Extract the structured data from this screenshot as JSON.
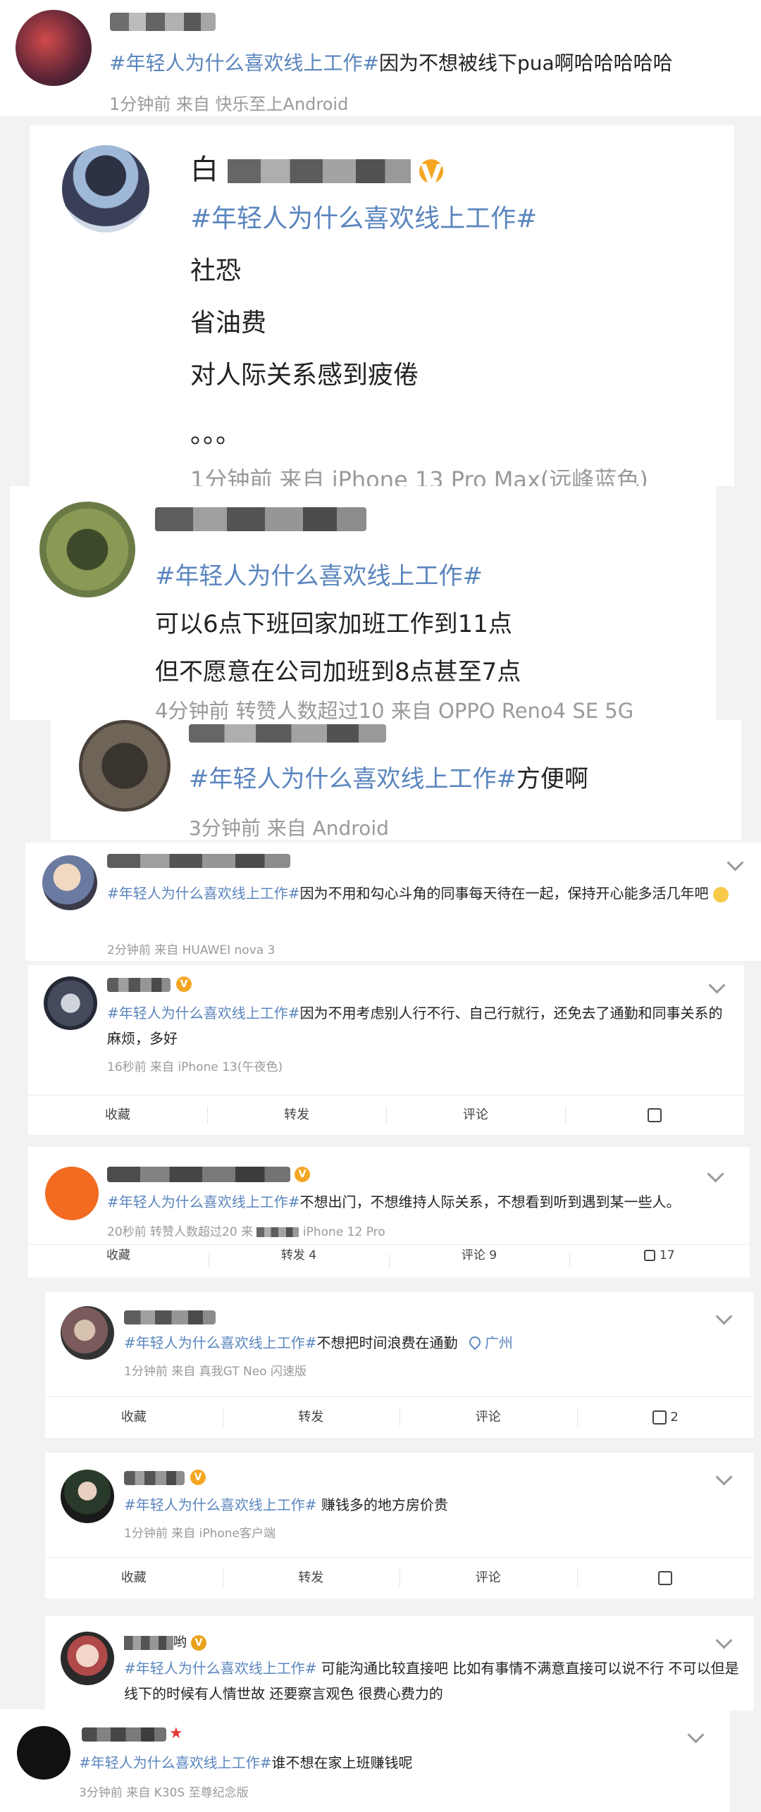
{
  "hashtag": "#年轻人为什么喜欢线上工作#",
  "colors": {
    "link": "#5a85be",
    "meta": "#9a9a9a",
    "badge": "#f4a623",
    "background": "#f2f2f2"
  },
  "posts": [
    {
      "name": "",
      "text": "因为不想被线下pua啊哈哈哈哈哈",
      "meta": "1分钟前  来自 快乐至上Android"
    },
    {
      "name": "白",
      "text_lines": [
        "社恐",
        "省油费",
        "对人际关系感到疲倦",
        "。。。"
      ],
      "meta": "1分钟前  来自 iPhone 13 Pro Max(远峰蓝色)"
    },
    {
      "name": "",
      "text_lines": [
        "可以6点下班回家加班工作到11点",
        "但不愿意在公司加班到8点甚至7点"
      ],
      "meta": "4分钟前  转赞人数超过10  来自 OPPO Reno4 SE 5G"
    },
    {
      "name": "",
      "text": "方便啊",
      "meta": "3分钟前  来自 Android"
    },
    {
      "name": "",
      "text": "因为不用和勾心斗角的同事每天待在一起，保持开心能多活几年吧",
      "meta": "2分钟前  来自 HUAWEI nova 3"
    },
    {
      "name": "",
      "text": "因为不用考虑别人行不行、自己行就行，还免去了通勤和同事关系的麻烦，多好",
      "meta": "16秒前  来自 iPhone 13(午夜色)",
      "actions": [
        "收藏",
        "转发",
        "评论",
        ""
      ]
    },
    {
      "name": "",
      "text": "不想出门，不想维持人际关系，不想看到听到遇到某一些人。",
      "meta": "20秒前  转赞人数超过20  来",
      "meta_tail": "iPhone 12 Pro",
      "actions": [
        "收藏",
        "转发 4",
        "评论 9",
        "17"
      ]
    },
    {
      "name": "",
      "text": "不想把时间浪费在通勤",
      "location": "广州",
      "meta": "1分钟前  来自 真我GT Neo 闪速版",
      "actions": [
        "收藏",
        "转发",
        "评论",
        "2"
      ]
    },
    {
      "name": "",
      "text": " 赚钱多的地方房价贵",
      "meta": "1分钟前  来自 iPhone客户端",
      "actions": [
        "收藏",
        "转发",
        "评论",
        ""
      ]
    },
    {
      "name": "哟",
      "text": " 可能沟通比较直接吧 比如有事情不满意直接可以说不行 不可以但是线下的时候有人情世故 还要察言观色 很费心费力的"
    },
    {
      "name": "",
      "text": "谁不想在家上班赚钱呢",
      "meta": "3分钟前  来自 K30S 至尊纪念版"
    }
  ]
}
